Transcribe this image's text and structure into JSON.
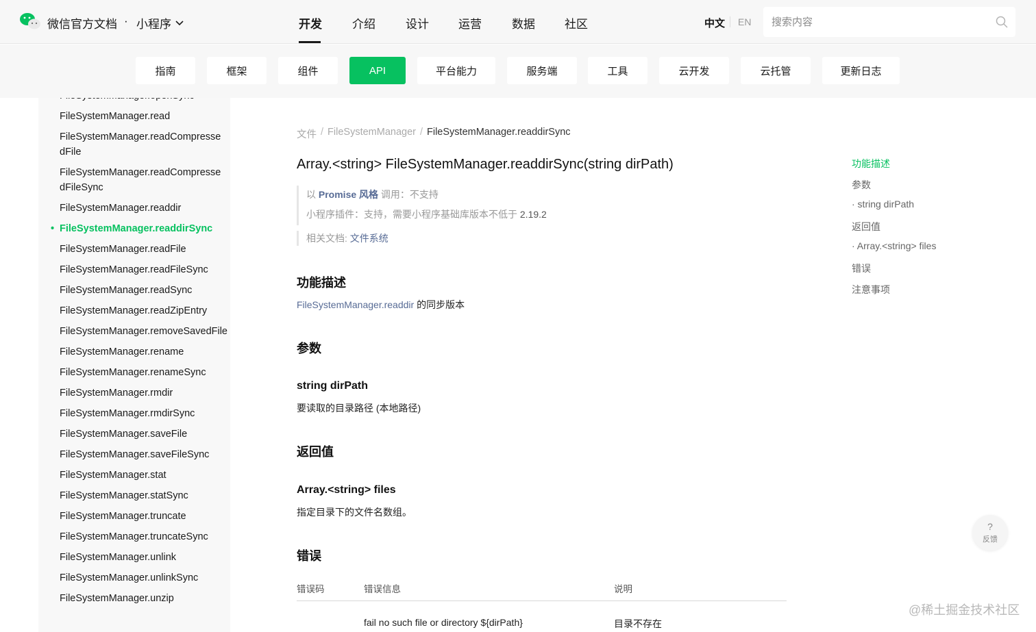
{
  "header": {
    "brand": "微信官方文档",
    "dot": "·",
    "product": "小程序",
    "nav": [
      "开发",
      "介绍",
      "设计",
      "运营",
      "数据",
      "社区"
    ],
    "lang_zh": "中文",
    "lang_en": "EN",
    "search_placeholder": "搜索内容"
  },
  "subnav": [
    "指南",
    "框架",
    "组件",
    "API",
    "平台能力",
    "服务端",
    "工具",
    "云开发",
    "云托管",
    "更新日志"
  ],
  "sidebar": {
    "items": [
      "FileSystemManager.openSync",
      "FileSystemManager.read",
      "FileSystemManager.readCompressedFile",
      "FileSystemManager.readCompressedFileSync",
      "FileSystemManager.readdir",
      "FileSystemManager.readdirSync",
      "FileSystemManager.readFile",
      "FileSystemManager.readFileSync",
      "FileSystemManager.readSync",
      "FileSystemManager.readZipEntry",
      "FileSystemManager.removeSavedFile",
      "FileSystemManager.rename",
      "FileSystemManager.renameSync",
      "FileSystemManager.rmdir",
      "FileSystemManager.rmdirSync",
      "FileSystemManager.saveFile",
      "FileSystemManager.saveFileSync",
      "FileSystemManager.stat",
      "FileSystemManager.statSync",
      "FileSystemManager.truncate",
      "FileSystemManager.truncateSync",
      "FileSystemManager.unlink",
      "FileSystemManager.unlinkSync",
      "FileSystemManager.unzip"
    ]
  },
  "breadcrumb": {
    "items": [
      "文件",
      "FileSystemManager",
      "FileSystemManager.readdirSync"
    ],
    "sep": "/"
  },
  "content": {
    "title": "Array.<string> FileSystemManager.readdirSync(string dirPath)",
    "promise_prefix": "以 ",
    "promise_style": "Promise 风格",
    "promise_suffix": " 调用：",
    "promise_value": "不支持",
    "plugin_label": "小程序插件：",
    "plugin_value": "支持，需要小程序基础库版本不低于",
    "plugin_version": " 2.19.2",
    "related_label": "相关文档: ",
    "related_link": "文件系统",
    "h_desc": "功能描述",
    "desc_link": "FileSystemManager.readdir",
    "desc_text": " 的同步版本",
    "h_params": "参数",
    "param_name": "string dirPath",
    "param_desc": "要读取的目录路径 (本地路径)",
    "h_return": "返回值",
    "return_name": "Array.<string> files",
    "return_desc": "指定目录下的文件名数组。",
    "h_errors": "错误",
    "table_headers": [
      "错误码",
      "错误信息",
      "说明"
    ],
    "table_row": [
      "",
      "fail no such file or directory ${dirPath}",
      "目录不存在"
    ]
  },
  "toc": [
    "功能描述",
    "参数",
    "· string dirPath",
    "返回值",
    "· Array.<string> files",
    "错误",
    "注意事项"
  ],
  "feedback": {
    "q": "?",
    "label": "反馈"
  },
  "watermark": "@稀土掘金技术社区",
  "colors": {
    "accent": "#07c160",
    "link": "#576b95"
  }
}
